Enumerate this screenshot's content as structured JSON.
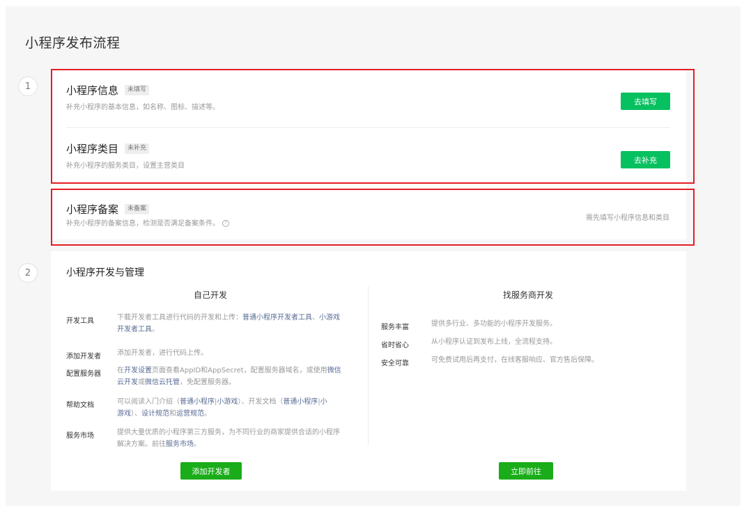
{
  "page": {
    "title": "小程序发布流程"
  },
  "step1": {
    "number": "1",
    "info": {
      "title": "小程序信息",
      "tag": "未填写",
      "desc": "补充小程序的基本信息，如名称、图标、描述等。",
      "button": "去填写"
    },
    "category": {
      "title": "小程序类目",
      "tag": "未补充",
      "desc": "补充小程序的服务类目，设置主营类目",
      "button": "去补充"
    },
    "filing": {
      "title": "小程序备案",
      "tag": "未备案",
      "desc": "补充小程序的备案信息，检测是否满足备案条件。",
      "hint": "需先填写小程序信息和类目"
    }
  },
  "step2": {
    "number": "2",
    "title": "小程序开发与管理",
    "self_dev": {
      "heading": "自己开发",
      "button": "添加开发者",
      "items": [
        {
          "label": "开发工具",
          "p1": "下载开发者工具进行代码的开发和上传：",
          "l1": "普通小程序开发者工具",
          "p2": "、",
          "l2": "小游戏",
          "l3": "开发者工具",
          "p3": "。"
        },
        {
          "label": "添加开发者",
          "p1": "添加开发者，进行代码上传。"
        },
        {
          "label": "配置服务器",
          "p1": "在",
          "l1": "开发设置",
          "p2": "页面查看AppID和AppSecret，配置服务器域名，或使用",
          "l2": "微信",
          "l3": "云开发",
          "p3": "或",
          "l4": "微信云托管",
          "p4": "，免配置服务器。"
        },
        {
          "label": "帮助文档",
          "p1": "可以阅读入门介绍（",
          "l1": "普通小程序",
          "p2": "|",
          "l2": "小游戏",
          "p3": "）、开发文档（",
          "l3": "普通小程序",
          "p4": "|",
          "l4": "小",
          "l5": "游戏",
          "p5": "）、",
          "l6": "设计规范",
          "p6": "和",
          "l7": "运营规范",
          "p7": "。"
        },
        {
          "label": "服务市场",
          "p1": "提供大量优质的小程序第三方服务，为不同行业的商家提供合适的小程序",
          "p2": "解决方案。前往",
          "l1": "服务市场",
          "p3": "。"
        }
      ]
    },
    "provider_dev": {
      "heading": "找服务商开发",
      "button": "立即前往",
      "items": [
        {
          "label": "服务丰富",
          "desc": "提供多行业、多功能的小程序开发服务。"
        },
        {
          "label": "省时省心",
          "desc": "从小程序认证到发布上线，全流程支持。"
        },
        {
          "label": "安全可靠",
          "desc": "可免费试用后再支付，在线客服响应、官方售后保障。"
        }
      ]
    }
  },
  "colors": {
    "primary_green": "#07c160",
    "button_green": "#1aad19",
    "link": "#576b95",
    "highlight_red": "#e51c23"
  }
}
